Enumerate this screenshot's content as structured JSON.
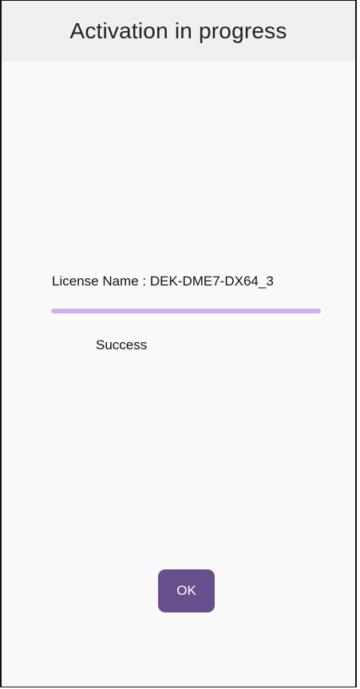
{
  "header": {
    "title": "Activation in progress"
  },
  "content": {
    "license_text": "License Name : DEK-DME7-DX64_3",
    "progress_fraction": 1.0,
    "status_text": "Success"
  },
  "actions": {
    "ok_label": "OK"
  },
  "colors": {
    "header_bg": "#f0f0f0",
    "page_bg": "#fafafa",
    "progress_fill": "#cdb0ee",
    "button_bg": "#66508c",
    "button_text": "#ffffff"
  }
}
